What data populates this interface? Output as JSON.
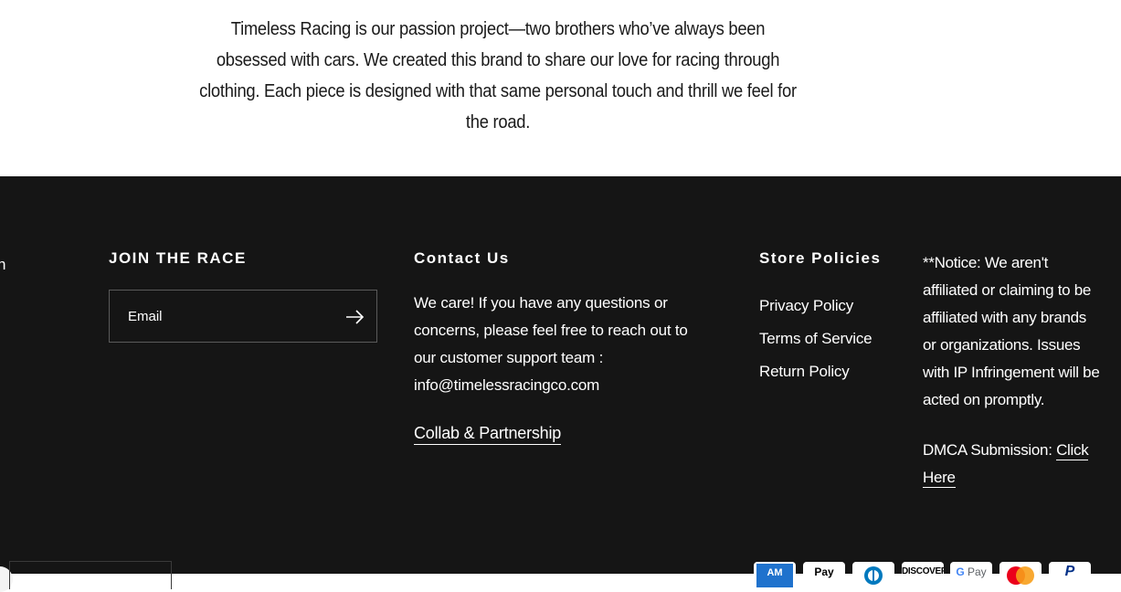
{
  "about": {
    "text": "Timeless Racing is our passion project—two brothers who’ve always been obsessed with cars. We created this brand to share our love for racing through clothing. Each piece is designed with that same personal touch and thrill we feel for the road."
  },
  "footer": {
    "edge_glyph": "n",
    "newsletter": {
      "heading": "JOIN THE RACE",
      "placeholder": "Email",
      "submit_icon": "arrow-right-icon"
    },
    "contact": {
      "heading": "Contact Us",
      "body": "We care! If you have any questions or concerns, please feel free to reach out to our customer support team : info@timelessracingco.com",
      "collab_link": "Collab & Partnership"
    },
    "policies": {
      "heading": "Store Policies",
      "items": [
        "Privacy Policy",
        "Terms of Service",
        "Return Policy"
      ]
    },
    "notice": {
      "text": "**Notice: We aren't affiliated or claiming to be affiliated with any brands or organizations. Issues with IP Infringement will be acted on promptly.",
      "dmca_label": "DMCA Submission: ",
      "dmca_link": "Click Here"
    },
    "payment_icons": [
      {
        "name": "amex-icon",
        "label": "AM",
        "color": "#1f72cd"
      },
      {
        "name": "apple-pay-icon",
        "label": " Pay",
        "color": "#000000"
      },
      {
        "name": "diners-club-icon",
        "label": "",
        "color": "#0079be"
      },
      {
        "name": "discover-icon",
        "label": "DISCOVER",
        "color": "#000000"
      },
      {
        "name": "google-pay-icon",
        "label": "G Pay",
        "color": "#5f6368"
      },
      {
        "name": "mastercard-icon",
        "label": "",
        "color": "#eb001b"
      },
      {
        "name": "paypal-icon",
        "label": "P",
        "color": "#003087"
      }
    ]
  }
}
